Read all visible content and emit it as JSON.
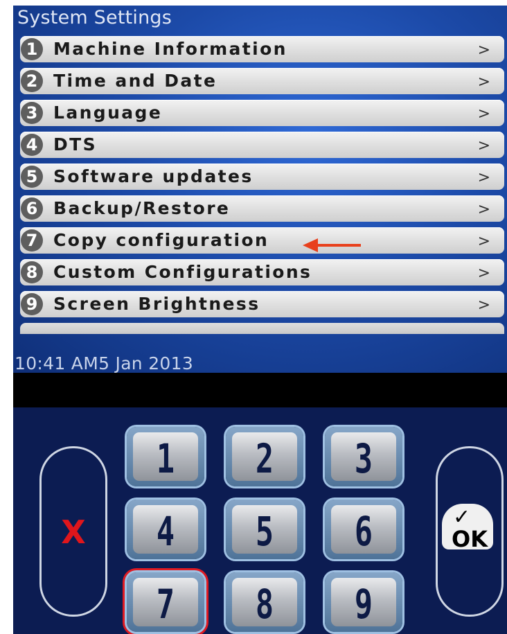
{
  "screen": {
    "title": "System Settings",
    "status": "10:41 AM5 Jan 2013",
    "menu": [
      {
        "number": "1",
        "label": "Machine Information",
        "chevron": ">"
      },
      {
        "number": "2",
        "label": "Time and Date",
        "chevron": ">"
      },
      {
        "number": "3",
        "label": "Language",
        "chevron": ">"
      },
      {
        "number": "4",
        "label": "DTS",
        "chevron": ">"
      },
      {
        "number": "5",
        "label": "Software updates",
        "chevron": ">"
      },
      {
        "number": "6",
        "label": "Backup/Restore",
        "chevron": ">"
      },
      {
        "number": "7",
        "label": "Copy configuration",
        "chevron": ">"
      },
      {
        "number": "8",
        "label": "Custom Configurations",
        "chevron": ">"
      },
      {
        "number": "9",
        "label": "Screen Brightness",
        "chevron": ">"
      }
    ],
    "annotation": {
      "icon": "red-arrow-left-icon",
      "points_to_item": "Copy configuration",
      "color": "#e8401c"
    }
  },
  "keypad": {
    "cancel_label": "X",
    "ok_label": "OK",
    "ok_check": "✓",
    "keys": [
      "1",
      "2",
      "3",
      "4",
      "5",
      "6",
      "7",
      "8",
      "9"
    ],
    "highlighted_key": "7",
    "highlight_color": "#e01a22"
  }
}
